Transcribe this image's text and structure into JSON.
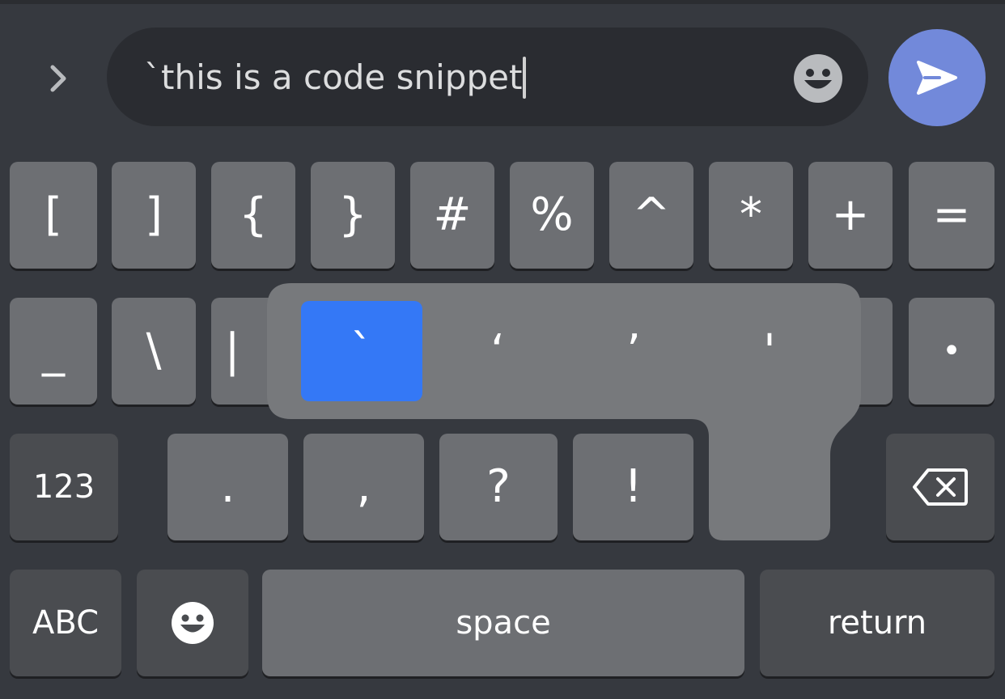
{
  "message_input": {
    "value": "`this is a code snippet"
  },
  "keyboard": {
    "row1": [
      "[",
      "]",
      "{",
      "}",
      "#",
      "%",
      "^",
      "*",
      "+",
      "="
    ],
    "row2": [
      "_",
      "\\",
      "|",
      "•"
    ],
    "row3": [
      ".",
      ",",
      "?",
      "!"
    ],
    "numbers_key": "123",
    "abc_key": "ABC",
    "space_key": "space",
    "return_key": "return",
    "accent_popup": [
      "`",
      "‘",
      "’",
      "'"
    ]
  },
  "colors": {
    "send_button": "#7289da",
    "popup_selected": "#3478f6",
    "key": "#6d6f73",
    "key_dark": "#4a4c50"
  },
  "icons": {
    "expand": "chevron-right-icon",
    "emoji": "emoji-face-icon",
    "send": "send-icon",
    "backspace": "backspace-icon",
    "keyboard_emoji": "emoji-face-icon"
  }
}
